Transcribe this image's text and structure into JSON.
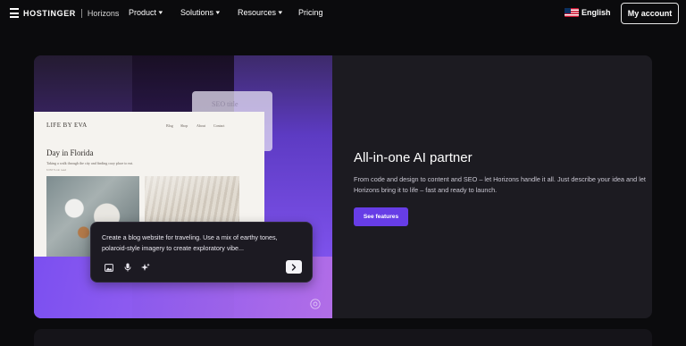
{
  "nav": {
    "brand": "HOSTINGER",
    "product": "Horizons",
    "links": [
      {
        "label": "Product",
        "has_menu": true
      },
      {
        "label": "Solutions",
        "has_menu": true
      },
      {
        "label": "Resources",
        "has_menu": true
      },
      {
        "label": "Pricing",
        "has_menu": false
      }
    ],
    "chevron": "▾",
    "language": "English",
    "language_icon": "us-flag-icon",
    "account_label": "My account"
  },
  "hero": {
    "headline": "All-in-one AI partner",
    "description": "From code and design to content and SEO – let Horizons handle it all. Just describe your idea and let Horizons bring it to life – fast and ready to launch.",
    "cta_label": "See features",
    "accent_color": "#673de6"
  },
  "preview": {
    "back_panel_text": "SEO title",
    "site": {
      "brand": "LIFE BY EVA",
      "nav": [
        "Blog",
        "Shop",
        "About",
        "Contact"
      ],
      "title": "Day in Florida",
      "subtitle": "Taking a walk through the city and finding cozy place to eat.",
      "meta": "6 PM    5 min read"
    },
    "prompt": {
      "text": "Create a blog website for traveling. Use a mix of earthy tones, polaroid-style imagery to create exploratory vibe...",
      "icons": [
        "image-icon",
        "microphone-icon",
        "sparkles-icon"
      ],
      "send_icon": "arrow-right-icon"
    }
  }
}
